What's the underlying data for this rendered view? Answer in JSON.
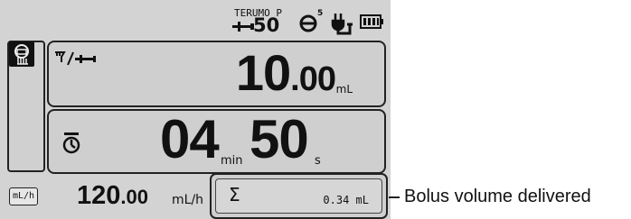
{
  "status_bar": {
    "syringe_brand": "TERUMO P",
    "syringe_size": "50",
    "occlusion_level": "5",
    "icons": [
      "syringe-icon",
      "occlusion-icon",
      "plug-icon",
      "battery-icon"
    ]
  },
  "side_panel": {
    "icons": [
      "keypad-lock-icon"
    ]
  },
  "volume_panel": {
    "icon": "infused-volume-icon",
    "value_int": "10",
    "value_dec": ".00",
    "unit": "mL"
  },
  "time_panel": {
    "icon": "timer-icon",
    "minutes": "04",
    "minutes_unit": "min",
    "seconds": "50",
    "seconds_unit": "s"
  },
  "rate": {
    "unit_badge": "mL/h",
    "value_int": "120",
    "value_dec": ".00",
    "unit": "mL/h"
  },
  "bolus": {
    "symbol": "Σ",
    "value": "0.34 mL"
  },
  "callout": {
    "text": "Bolus volume delivered"
  },
  "colors": {
    "screen_bg": "#d3d3d3",
    "panel_bg": "#cfcfcf",
    "ink": "#111111",
    "border": "#222222"
  }
}
